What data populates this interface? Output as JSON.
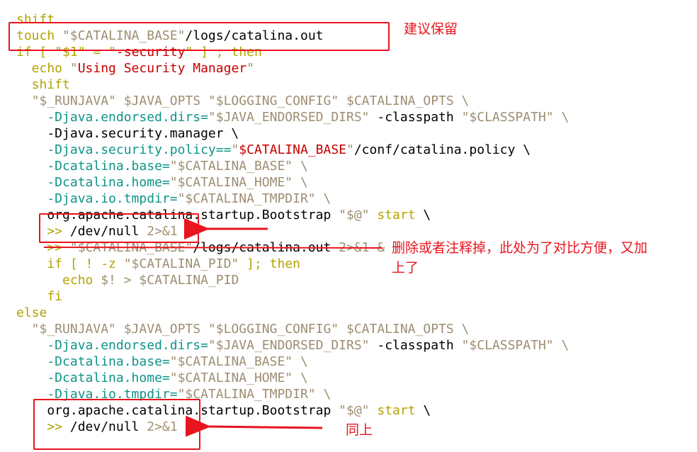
{
  "colors": {
    "keyword": "#b3a300",
    "string": "#9d8e72",
    "string_emphasis": "#c40000",
    "plain": "#000000",
    "property": "#0e9488",
    "annotation": "#e8141e"
  },
  "code_lines": [
    {
      "tokens": [
        {
          "text": "shift",
          "type": "keyword"
        }
      ]
    },
    {
      "tokens": [
        {
          "text": "touch ",
          "type": "keyword"
        },
        {
          "text": "\"$CATALINA_BASE\"",
          "type": "string"
        },
        {
          "text": "/logs/catalina.out",
          "type": "plain"
        }
      ]
    },
    {
      "tokens": [
        {
          "text": "if [ \"$1\" = \"",
          "type": "keyword"
        },
        {
          "text": "-security",
          "type": "strong"
        },
        {
          "text": "\" ] ; then",
          "type": "keyword"
        }
      ]
    },
    {
      "tokens": [
        {
          "text": "  echo ",
          "type": "keyword"
        },
        {
          "text": "\"",
          "type": "string"
        },
        {
          "text": "Using Security Manager",
          "type": "strong"
        },
        {
          "text": "\"",
          "type": "string"
        }
      ]
    },
    {
      "tokens": [
        {
          "text": "  shift",
          "type": "keyword"
        }
      ]
    },
    {
      "tokens": [
        {
          "text": "  \"$_RUNJAVA\" $JAVA_OPTS \"$LOGGING_CONFIG\" $CATALINA_OPTS \\",
          "type": "string"
        }
      ]
    },
    {
      "tokens": [
        {
          "text": "    -Djava.endorsed.dirs=",
          "type": "prop"
        },
        {
          "text": "\"$JAVA_ENDORSED_DIRS\" ",
          "type": "string"
        },
        {
          "text": "-classpath ",
          "type": "plain"
        },
        {
          "text": "\"$CLASSPATH\" \\",
          "type": "string"
        }
      ]
    },
    {
      "tokens": [
        {
          "text": "    -Djava.security.manager \\",
          "type": "plain"
        }
      ]
    },
    {
      "tokens": [
        {
          "text": "    -Djava.security.policy==",
          "type": "prop"
        },
        {
          "text": "\"",
          "type": "string"
        },
        {
          "text": "$CATALINA_BASE",
          "type": "strong"
        },
        {
          "text": "\"",
          "type": "string"
        },
        {
          "text": "/conf/catalina.policy \\",
          "type": "plain"
        }
      ]
    },
    {
      "tokens": [
        {
          "text": "    -Dcatalina.base=",
          "type": "prop"
        },
        {
          "text": "\"$CATALINA_BASE\" \\",
          "type": "string"
        }
      ]
    },
    {
      "tokens": [
        {
          "text": "    -Dcatalina.home=",
          "type": "prop"
        },
        {
          "text": "\"$CATALINA_HOME\" \\",
          "type": "string"
        }
      ]
    },
    {
      "tokens": [
        {
          "text": "    -Djava.io.tmpdir=",
          "type": "prop"
        },
        {
          "text": "\"$CATALINA_TMPDIR\" \\",
          "type": "string"
        }
      ]
    },
    {
      "tokens": [
        {
          "text": "    org.apache.catalina.startup.Bootstrap ",
          "type": "plain"
        },
        {
          "text": "\"$@\" ",
          "type": "string"
        },
        {
          "text": "start ",
          "type": "keyword"
        },
        {
          "text": "\\",
          "type": "plain"
        }
      ]
    },
    {
      "tokens": [
        {
          "text": "    >> ",
          "type": "keyword"
        },
        {
          "text": "/dev/null ",
          "type": "plain"
        },
        {
          "text": "2>&1 &",
          "type": "muted"
        }
      ]
    },
    {
      "tokens": [
        {
          "text": "    >> ",
          "type": "keyword"
        },
        {
          "text": "\"$CATALINA_BASE\"",
          "type": "string"
        },
        {
          "text": "/logs/catalina.out ",
          "type": "plain"
        },
        {
          "text": "2>&1 &",
          "type": "muted"
        }
      ]
    },
    {
      "tokens": [
        {
          "text": "    if [ ! -z ",
          "type": "keyword"
        },
        {
          "text": "\"$CATALINA_PID\" ",
          "type": "string"
        },
        {
          "text": "]; then",
          "type": "keyword"
        }
      ]
    },
    {
      "tokens": [
        {
          "text": "      echo ",
          "type": "keyword"
        },
        {
          "text": "$! > $CATALINA_PID",
          "type": "string"
        }
      ]
    },
    {
      "tokens": [
        {
          "text": "    fi",
          "type": "keyword"
        }
      ]
    },
    {
      "tokens": [
        {
          "text": "else",
          "type": "keyword"
        }
      ]
    },
    {
      "tokens": [
        {
          "text": "  \"$_RUNJAVA\" $JAVA_OPTS \"$LOGGING_CONFIG\" $CATALINA_OPTS \\",
          "type": "string"
        }
      ]
    },
    {
      "tokens": [
        {
          "text": "    -Djava.endorsed.dirs=",
          "type": "prop"
        },
        {
          "text": "\"$JAVA_ENDORSED_DIRS\" ",
          "type": "string"
        },
        {
          "text": "-classpath ",
          "type": "plain"
        },
        {
          "text": "\"$CLASSPATH\" \\",
          "type": "string"
        }
      ]
    },
    {
      "tokens": [
        {
          "text": "    -Dcatalina.base=",
          "type": "prop"
        },
        {
          "text": "\"$CATALINA_BASE\" \\",
          "type": "string"
        }
      ]
    },
    {
      "tokens": [
        {
          "text": "    -Dcatalina.home=",
          "type": "prop"
        },
        {
          "text": "\"$CATALINA_HOME\" \\",
          "type": "string"
        }
      ]
    },
    {
      "tokens": [
        {
          "text": "    -Djava.io.tmpdir=",
          "type": "prop"
        },
        {
          "text": "\"$CATALINA_TMPDIR\" \\",
          "type": "string"
        }
      ]
    },
    {
      "tokens": [
        {
          "text": "    org.apache.catalina.startup.Bootstrap ",
          "type": "plain"
        },
        {
          "text": "\"$@\" ",
          "type": "string"
        },
        {
          "text": "start ",
          "type": "keyword"
        },
        {
          "text": "\\",
          "type": "plain"
        }
      ]
    },
    {
      "tokens": [
        {
          "text": "    >> ",
          "type": "keyword"
        },
        {
          "text": "/dev/null ",
          "type": "plain"
        },
        {
          "text": "2>&1 &",
          "type": "muted"
        }
      ]
    }
  ],
  "annotations": {
    "keep_note": "建议保留",
    "delete_note_line1": "删除或者注释掉，此处为了对比方便，又加",
    "delete_note_line2": "上了",
    "same_note": "同上"
  }
}
